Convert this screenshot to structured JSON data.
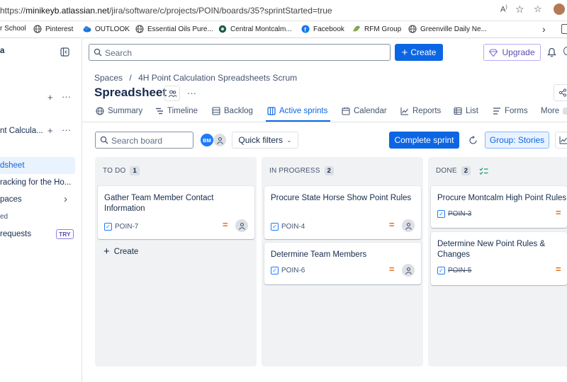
{
  "browser": {
    "url_prefix": "https://",
    "url_host": "minikeyb.atlassian.net",
    "url_path": "/jira/software/c/projects/POIN/boards/35?sprintStarted=true",
    "bookmarks": [
      {
        "label": "r School",
        "icon": "globe-icon"
      },
      {
        "label": "Pinterest",
        "icon": "globe-icon"
      },
      {
        "label": "OUTLOOK",
        "icon": "cloud-icon"
      },
      {
        "label": "Essential Oils Pure...",
        "icon": "globe-icon"
      },
      {
        "label": "Central Montcalm...",
        "icon": "circle-icon"
      },
      {
        "label": "Facebook",
        "icon": "facebook-icon"
      },
      {
        "label": "RFM Group",
        "icon": "leaf-icon"
      },
      {
        "label": "Greenville Daily Ne...",
        "icon": "globe-icon"
      }
    ]
  },
  "topnav": {
    "app_name": "a",
    "search_placeholder": "Search",
    "create_label": "Create",
    "upgrade_label": "Upgrade"
  },
  "sidebar": {
    "project_name": "nt Calcula...",
    "items": [
      {
        "label": "dsheet",
        "active": true
      },
      {
        "label": "racking for the Ho..."
      },
      {
        "label": "paces"
      },
      {
        "label": "ed"
      },
      {
        "label": " requests",
        "badge": "TRY"
      }
    ]
  },
  "project": {
    "breadcrumb_spaces": "Spaces",
    "breadcrumb_sep": "/",
    "breadcrumb_project": "4H Point Calculation Spreadsheets Scrum",
    "title": "Spreadsheet",
    "tabs": [
      "Summary",
      "Timeline",
      "Backlog",
      "Active sprints",
      "Calendar",
      "Reports",
      "List",
      "Forms",
      "More"
    ],
    "active_tab": "Active sprints"
  },
  "board": {
    "search_placeholder": "Search board",
    "avatar_initials": "BM",
    "quick_filters_label": "Quick filters",
    "complete_sprint_label": "Complete sprint",
    "group_label": "Group: Stories",
    "create_label": "Create",
    "columns": [
      {
        "name": "TO DO",
        "count": "1",
        "cards": [
          {
            "title": "Gather Team Member Contact Information",
            "key": "POIN-7",
            "done": false
          }
        ]
      },
      {
        "name": "IN PROGRESS",
        "count": "2",
        "cards": [
          {
            "title": "Procure State Horse Show Point Rules",
            "key": "POIN-4",
            "done": false
          },
          {
            "title": "Determine Team Members",
            "key": "POIN-6",
            "done": false
          }
        ]
      },
      {
        "name": "DONE",
        "count": "2",
        "cards": [
          {
            "title": "Procure Montcalm High Point Rules",
            "key": "POIN-3",
            "done": true
          },
          {
            "title": "Determine New Point Rules & Changes",
            "key": "POIN-5",
            "done": true
          }
        ]
      }
    ]
  },
  "colors": {
    "accent": "#0c66e4",
    "priority": "#e56910",
    "done_check": "#22a06b"
  }
}
